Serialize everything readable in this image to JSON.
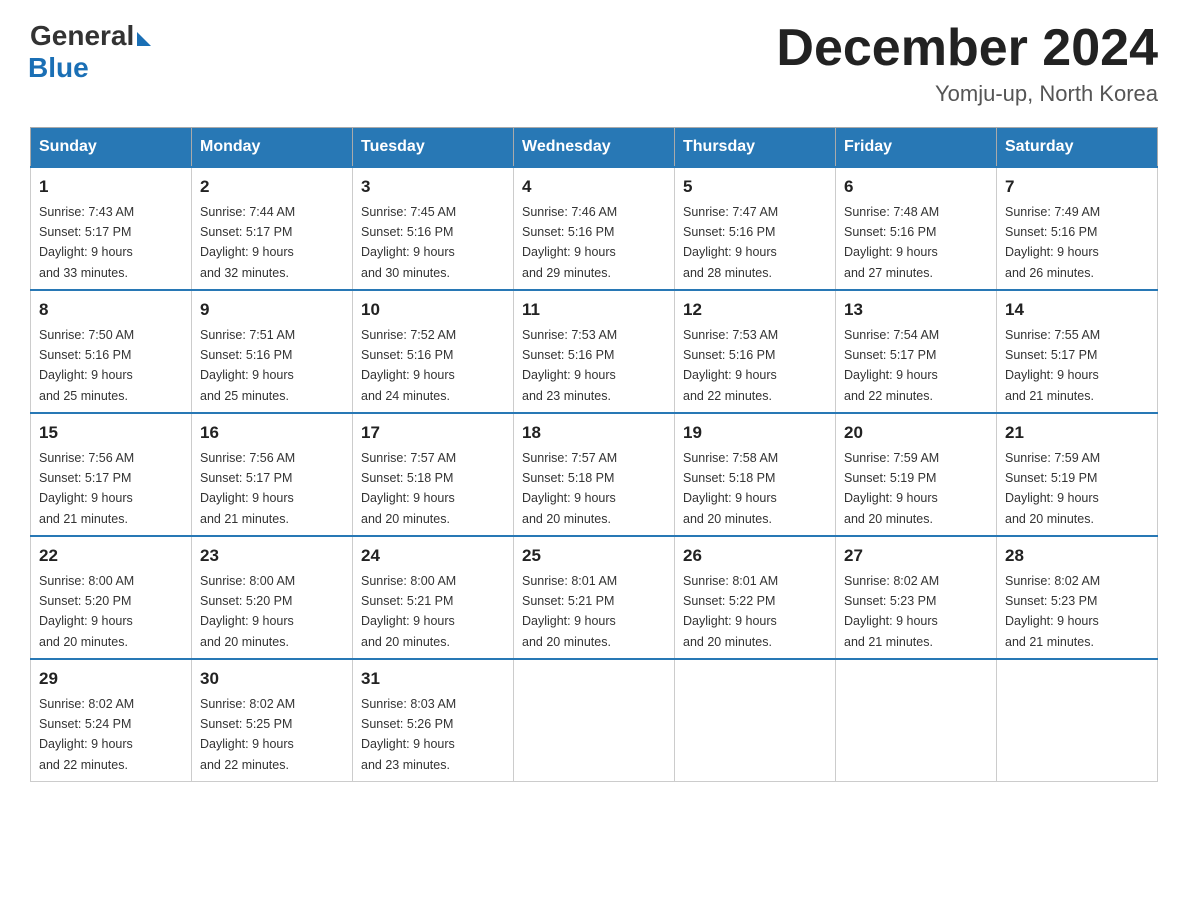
{
  "header": {
    "logo_general": "General",
    "logo_blue": "Blue",
    "month_year": "December 2024",
    "location": "Yomju-up, North Korea"
  },
  "days_of_week": [
    "Sunday",
    "Monday",
    "Tuesday",
    "Wednesday",
    "Thursday",
    "Friday",
    "Saturday"
  ],
  "weeks": [
    [
      {
        "num": "1",
        "sunrise": "7:43 AM",
        "sunset": "5:17 PM",
        "daylight": "9 hours and 33 minutes."
      },
      {
        "num": "2",
        "sunrise": "7:44 AM",
        "sunset": "5:17 PM",
        "daylight": "9 hours and 32 minutes."
      },
      {
        "num": "3",
        "sunrise": "7:45 AM",
        "sunset": "5:16 PM",
        "daylight": "9 hours and 30 minutes."
      },
      {
        "num": "4",
        "sunrise": "7:46 AM",
        "sunset": "5:16 PM",
        "daylight": "9 hours and 29 minutes."
      },
      {
        "num": "5",
        "sunrise": "7:47 AM",
        "sunset": "5:16 PM",
        "daylight": "9 hours and 28 minutes."
      },
      {
        "num": "6",
        "sunrise": "7:48 AM",
        "sunset": "5:16 PM",
        "daylight": "9 hours and 27 minutes."
      },
      {
        "num": "7",
        "sunrise": "7:49 AM",
        "sunset": "5:16 PM",
        "daylight": "9 hours and 26 minutes."
      }
    ],
    [
      {
        "num": "8",
        "sunrise": "7:50 AM",
        "sunset": "5:16 PM",
        "daylight": "9 hours and 25 minutes."
      },
      {
        "num": "9",
        "sunrise": "7:51 AM",
        "sunset": "5:16 PM",
        "daylight": "9 hours and 25 minutes."
      },
      {
        "num": "10",
        "sunrise": "7:52 AM",
        "sunset": "5:16 PM",
        "daylight": "9 hours and 24 minutes."
      },
      {
        "num": "11",
        "sunrise": "7:53 AM",
        "sunset": "5:16 PM",
        "daylight": "9 hours and 23 minutes."
      },
      {
        "num": "12",
        "sunrise": "7:53 AM",
        "sunset": "5:16 PM",
        "daylight": "9 hours and 22 minutes."
      },
      {
        "num": "13",
        "sunrise": "7:54 AM",
        "sunset": "5:17 PM",
        "daylight": "9 hours and 22 minutes."
      },
      {
        "num": "14",
        "sunrise": "7:55 AM",
        "sunset": "5:17 PM",
        "daylight": "9 hours and 21 minutes."
      }
    ],
    [
      {
        "num": "15",
        "sunrise": "7:56 AM",
        "sunset": "5:17 PM",
        "daylight": "9 hours and 21 minutes."
      },
      {
        "num": "16",
        "sunrise": "7:56 AM",
        "sunset": "5:17 PM",
        "daylight": "9 hours and 21 minutes."
      },
      {
        "num": "17",
        "sunrise": "7:57 AM",
        "sunset": "5:18 PM",
        "daylight": "9 hours and 20 minutes."
      },
      {
        "num": "18",
        "sunrise": "7:57 AM",
        "sunset": "5:18 PM",
        "daylight": "9 hours and 20 minutes."
      },
      {
        "num": "19",
        "sunrise": "7:58 AM",
        "sunset": "5:18 PM",
        "daylight": "9 hours and 20 minutes."
      },
      {
        "num": "20",
        "sunrise": "7:59 AM",
        "sunset": "5:19 PM",
        "daylight": "9 hours and 20 minutes."
      },
      {
        "num": "21",
        "sunrise": "7:59 AM",
        "sunset": "5:19 PM",
        "daylight": "9 hours and 20 minutes."
      }
    ],
    [
      {
        "num": "22",
        "sunrise": "8:00 AM",
        "sunset": "5:20 PM",
        "daylight": "9 hours and 20 minutes."
      },
      {
        "num": "23",
        "sunrise": "8:00 AM",
        "sunset": "5:20 PM",
        "daylight": "9 hours and 20 minutes."
      },
      {
        "num": "24",
        "sunrise": "8:00 AM",
        "sunset": "5:21 PM",
        "daylight": "9 hours and 20 minutes."
      },
      {
        "num": "25",
        "sunrise": "8:01 AM",
        "sunset": "5:21 PM",
        "daylight": "9 hours and 20 minutes."
      },
      {
        "num": "26",
        "sunrise": "8:01 AM",
        "sunset": "5:22 PM",
        "daylight": "9 hours and 20 minutes."
      },
      {
        "num": "27",
        "sunrise": "8:02 AM",
        "sunset": "5:23 PM",
        "daylight": "9 hours and 21 minutes."
      },
      {
        "num": "28",
        "sunrise": "8:02 AM",
        "sunset": "5:23 PM",
        "daylight": "9 hours and 21 minutes."
      }
    ],
    [
      {
        "num": "29",
        "sunrise": "8:02 AM",
        "sunset": "5:24 PM",
        "daylight": "9 hours and 22 minutes."
      },
      {
        "num": "30",
        "sunrise": "8:02 AM",
        "sunset": "5:25 PM",
        "daylight": "9 hours and 22 minutes."
      },
      {
        "num": "31",
        "sunrise": "8:03 AM",
        "sunset": "5:26 PM",
        "daylight": "9 hours and 23 minutes."
      },
      null,
      null,
      null,
      null
    ]
  ]
}
